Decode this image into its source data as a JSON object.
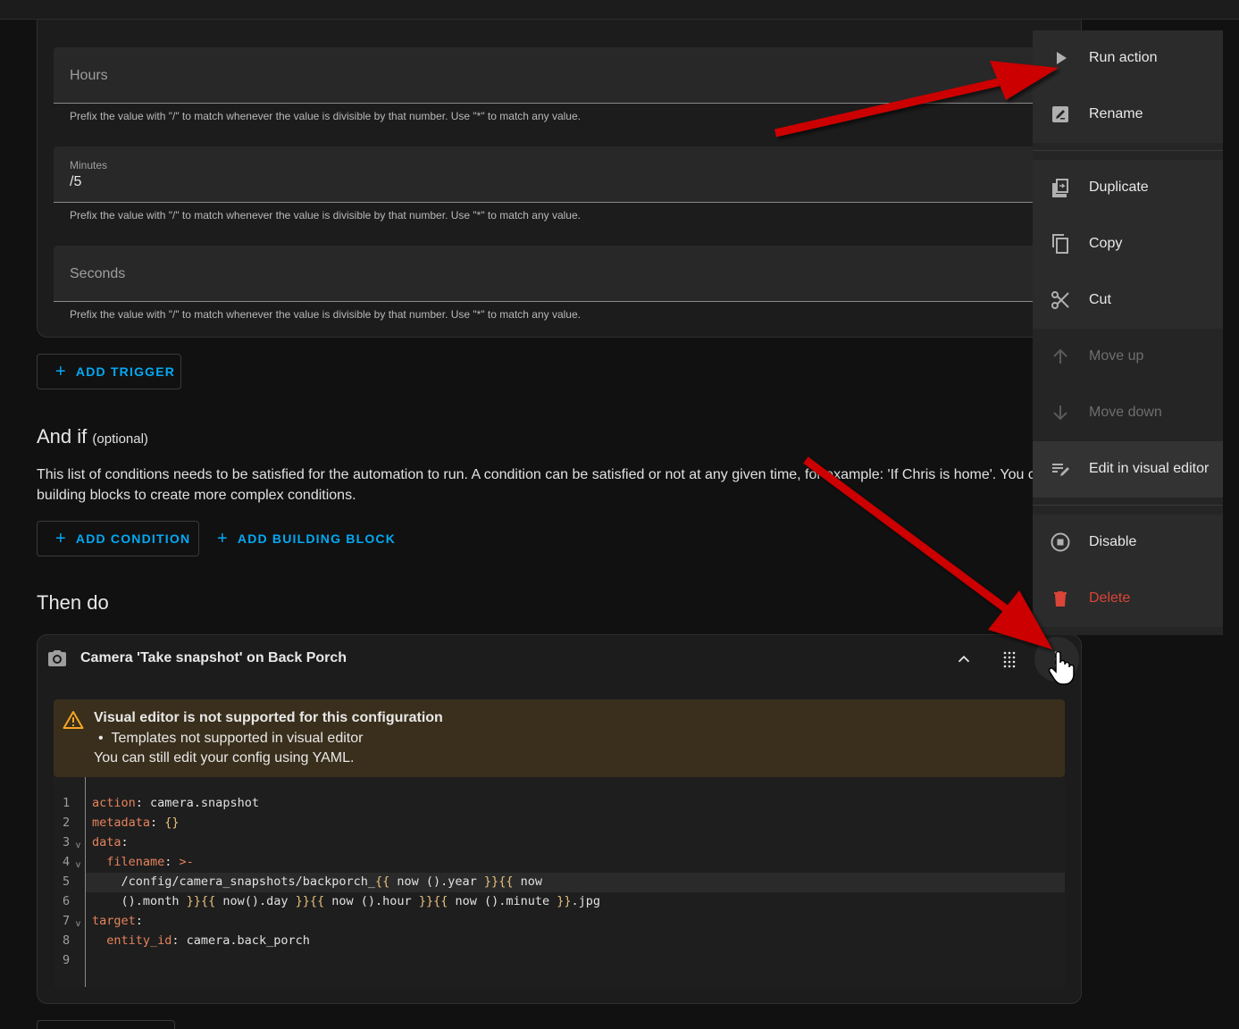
{
  "trigger": {
    "hours_placeholder": "Hours",
    "minutes_label": "Minutes",
    "minutes_value": "/5",
    "seconds_placeholder": "Seconds",
    "help_text": "Prefix the value with \"/\" to match whenever the value is divisible by that number. Use \"*\" to match any value.",
    "add_trigger_label": "ADD TRIGGER"
  },
  "conditions": {
    "heading": "And if",
    "heading_suffix": "(optional)",
    "description_line1": "This list of conditions needs to be satisfied for the automation to run. A condition can be satisfied or not at any given time, for example: 'If Chris is home'. You ca",
    "description_line2": "building blocks to create more complex conditions.",
    "add_condition_label": "ADD CONDITION",
    "add_building_block_label": "ADD BUILDING BLOCK"
  },
  "actions": {
    "heading": "Then do",
    "card_title": "Camera 'Take snapshot' on Back Porch",
    "warning_title": "Visual editor is not supported for this configuration",
    "warning_bullet": "Templates not supported in visual editor",
    "warning_footer": "You can still edit your config using YAML.",
    "code_lines": [
      {
        "num": "1",
        "key": "action",
        "rest": ": camera.snapshot"
      },
      {
        "num": "2",
        "key": "metadata",
        "rest": ": {}"
      },
      {
        "num": "3",
        "key": "data",
        "rest": ":"
      },
      {
        "num": "4",
        "key": "  filename",
        "rest": ": >-"
      },
      {
        "num": "5",
        "key": "",
        "rest": "    /config/camera_snapshots/backporch_{{ now ().year }}{{ now"
      },
      {
        "num": "6",
        "key": "",
        "rest": "    ().month }}{{ now().day }}{{ now ().hour }}{{ now ().minute }}.jpg"
      },
      {
        "num": "7",
        "key": "target",
        "rest": ":"
      },
      {
        "num": "8",
        "key": "  entity_id",
        "rest": ": camera.back_porch"
      },
      {
        "num": "9",
        "key": "",
        "rest": ""
      }
    ]
  },
  "menu": {
    "items": [
      {
        "label": "Run action",
        "icon": "play-icon"
      },
      {
        "label": "Rename",
        "icon": "rename-icon"
      },
      {
        "label": "Duplicate",
        "icon": "duplicate-icon"
      },
      {
        "label": "Copy",
        "icon": "copy-icon"
      },
      {
        "label": "Cut",
        "icon": "scissors-icon"
      },
      {
        "label": "Move up",
        "icon": "arrow-up-icon"
      },
      {
        "label": "Move down",
        "icon": "arrow-down-icon"
      },
      {
        "label": "Edit in visual editor",
        "icon": "edit-visual-icon"
      },
      {
        "label": "Disable",
        "icon": "disable-icon"
      },
      {
        "label": "Delete",
        "icon": "trash-icon"
      }
    ]
  },
  "colors": {
    "accent": "#03a9f4",
    "delete": "#db4437",
    "warning": "#f5a623",
    "annotation_arrow": "#cc0000"
  }
}
